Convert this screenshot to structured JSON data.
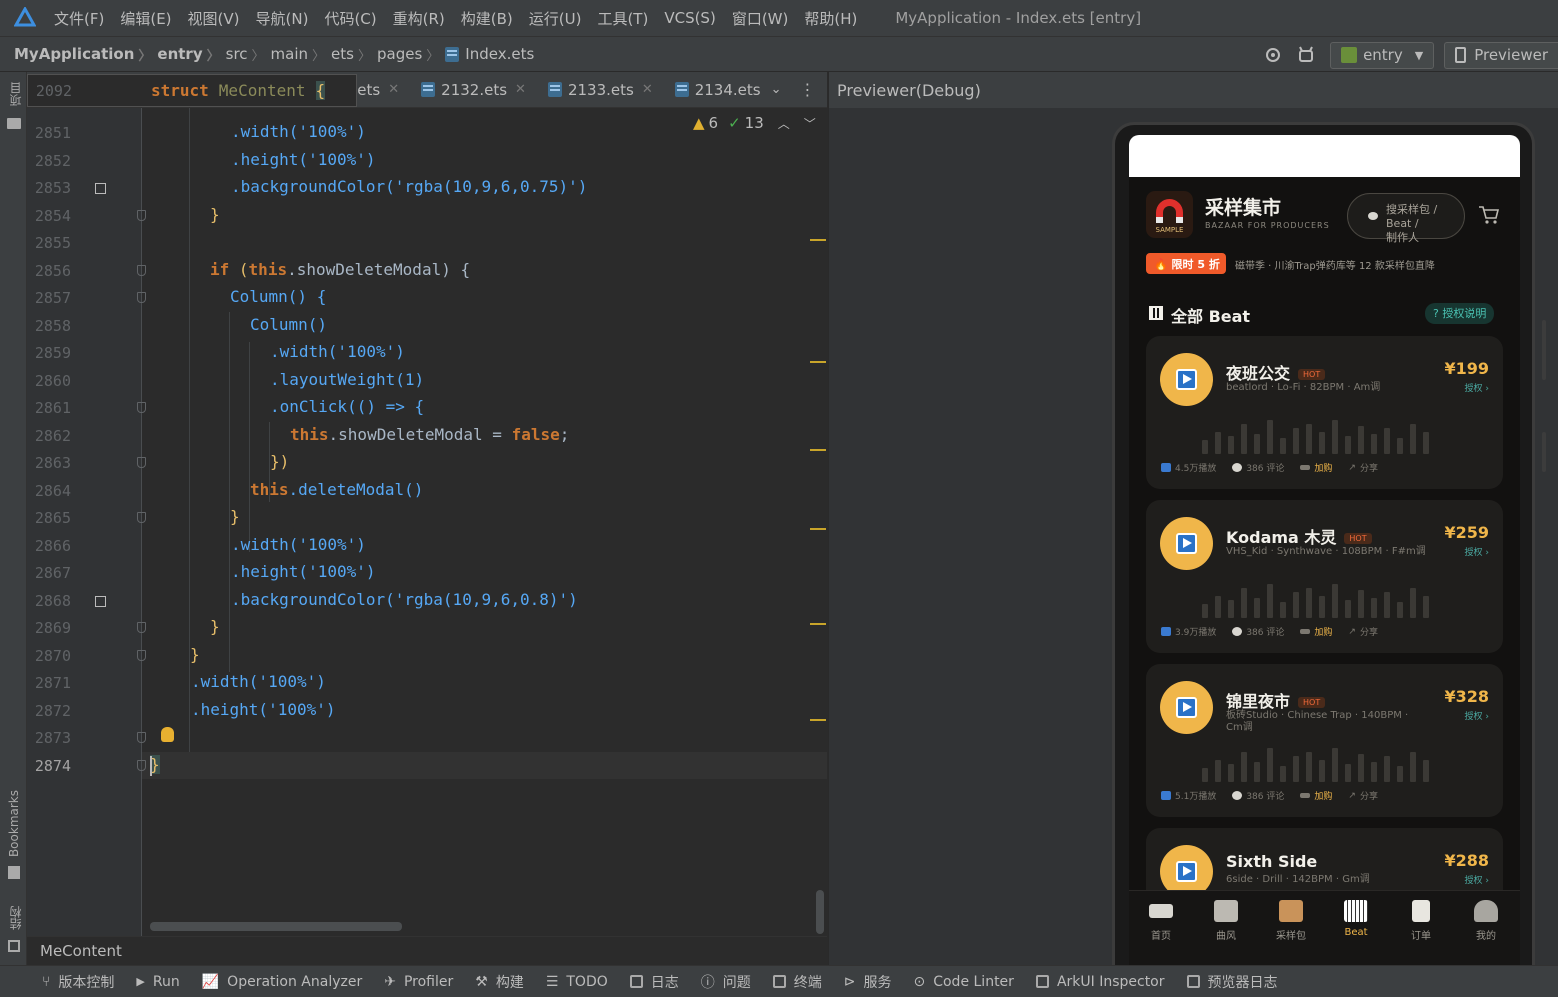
{
  "menubar": {
    "items": [
      "文件(F)",
      "编辑(E)",
      "视图(V)",
      "导航(N)",
      "代码(C)",
      "重构(R)",
      "构建(B)",
      "运行(U)",
      "工具(T)",
      "VCS(S)",
      "窗口(W)",
      "帮助(H)"
    ],
    "window_title": "MyApplication - Index.ets [entry]"
  },
  "breadcrumb": [
    "MyApplication",
    "entry",
    "src",
    "main",
    "ets",
    "pages",
    "Index.ets"
  ],
  "toolbar": {
    "module": "entry",
    "previewer": "Previewer"
  },
  "left_strip": {
    "project": "项目",
    "bookmarks": "Bookmarks",
    "structure": "结构"
  },
  "tabs": [
    {
      "label": "1.ets"
    },
    {
      "label": "2132.ets"
    },
    {
      "label": "2133.ets"
    },
    {
      "label": "2134.ets"
    }
  ],
  "sticky": {
    "line": "2092",
    "keyword": "struct",
    "name": "MeContent",
    "brace": "{"
  },
  "inspections": {
    "warnings": "6",
    "ok": "13"
  },
  "code_lines": [
    {
      "n": "2851"
    },
    {
      "n": "2852"
    },
    {
      "n": "2853"
    },
    {
      "n": "2854"
    },
    {
      "n": "2855"
    },
    {
      "n": "2856"
    },
    {
      "n": "2857"
    },
    {
      "n": "2858"
    },
    {
      "n": "2859"
    },
    {
      "n": "2860"
    },
    {
      "n": "2861"
    },
    {
      "n": "2862"
    },
    {
      "n": "2863"
    },
    {
      "n": "2864"
    },
    {
      "n": "2865"
    },
    {
      "n": "2866"
    },
    {
      "n": "2867"
    },
    {
      "n": "2868"
    },
    {
      "n": "2869"
    },
    {
      "n": "2870"
    },
    {
      "n": "2871"
    },
    {
      "n": "2872"
    },
    {
      "n": "2873"
    },
    {
      "n": "2874"
    }
  ],
  "code_text": {
    "l2851": ".width('100%')",
    "l2852": ".height('100%')",
    "l2853": ".backgroundColor('rgba(10,9,6,0.75)')",
    "l2856_a": "if",
    "l2856_b": "this",
    "l2856_c": ".showDeleteModal) {",
    "l2857": "Column() {",
    "l2858": "Column()",
    "l2859": ".width('100%')",
    "l2860": ".layoutWeight(1)",
    "l2861": ".onClick(() => {",
    "l2862_a": "this",
    "l2862_b": ".showDeleteModal = ",
    "l2862_c": "false",
    "l2862_d": ";",
    "l2863": "})",
    "l2864_a": "this",
    "l2864_b": ".deleteModal()",
    "l2866": ".width('100%')",
    "l2867": ".height('100%')",
    "l2868": ".backgroundColor('rgba(10,9,6,0.8)')",
    "l2871": ".width('100%')",
    "l2872": ".height('100%')"
  },
  "status_context": "MeContent",
  "preview": {
    "title": "Previewer(Debug)",
    "app": {
      "name": "采样集市",
      "subtitle": "BAZAAR FOR PRODUCERS",
      "logo_text": "SAMPLE",
      "search_placeholder_1": "搜采样包 / Beat /",
      "search_placeholder_2": "制作人",
      "promo_badge": "🔥 限时 5 折",
      "promo_text": "磁带季 · 川渝Trap弹药库等 12 款采样包直降",
      "section_title": "全部 Beat",
      "license_link": "? 授权说明"
    },
    "cards": [
      {
        "title": "夜班公交",
        "hot": "HOT",
        "meta": "beatlord · Lo-Fi · 82BPM · Am调",
        "price": "¥199",
        "auth": "授权 ›",
        "plays": "4.5万播放",
        "comments": "386 评论",
        "cart": "加购",
        "share": "分享"
      },
      {
        "title": "Kodama 木灵",
        "hot": "HOT",
        "meta": "VHS_Kid · Synthwave · 108BPM · F#m调",
        "price": "¥259",
        "auth": "授权 ›",
        "plays": "3.9万播放",
        "comments": "386 评论",
        "cart": "加购",
        "share": "分享"
      },
      {
        "title": "锦里夜市",
        "hot": "HOT",
        "meta": "板砖Studio · Chinese Trap · 140BPM · Cm调",
        "price": "¥328",
        "auth": "授权 ›",
        "plays": "5.1万播放",
        "comments": "386 评论",
        "cart": "加购",
        "share": "分享"
      },
      {
        "title": "Sixth Side",
        "hot": "",
        "meta": "6side · Drill · 142BPM · Gm调",
        "price": "¥288",
        "auth": "授权 ›",
        "plays": "",
        "comments": "",
        "cart": "",
        "share": ""
      }
    ],
    "tabbar": [
      {
        "label": "首页",
        "active": false
      },
      {
        "label": "曲风",
        "active": false
      },
      {
        "label": "采样包",
        "active": false
      },
      {
        "label": "Beat",
        "active": true
      },
      {
        "label": "订单",
        "active": false
      },
      {
        "label": "我的",
        "active": false
      }
    ]
  },
  "bottom_tools": [
    "版本控制",
    "Run",
    "Operation Analyzer",
    "Profiler",
    "构建",
    "TODO",
    "日志",
    "问题",
    "终端",
    "服务",
    "Code Linter",
    "ArkUI Inspector",
    "预览器日志"
  ],
  "colors": {
    "accent": "#f0b64a",
    "promo": "#f05a2a",
    "teal": "#4aa8a0",
    "ide_bg": "#2b2b2b"
  }
}
